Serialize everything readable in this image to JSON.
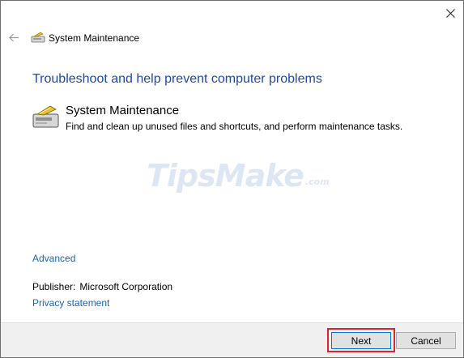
{
  "window": {
    "title": "System Maintenance",
    "close_icon": "close-icon",
    "back_icon": "back-arrow-icon"
  },
  "main": {
    "heading": "Troubleshoot and help prevent computer problems",
    "tool": {
      "icon": "system-maintenance-icon",
      "name": "System Maintenance",
      "description": "Find and clean up unused files and shortcuts, and perform maintenance tasks."
    },
    "watermark": {
      "text": "TipsMake",
      "domain": ".com"
    },
    "advanced_label": "Advanced",
    "publisher_label": "Publisher:",
    "publisher_name": "Microsoft Corporation",
    "privacy_label": "Privacy statement"
  },
  "footer": {
    "next_label": "Next",
    "cancel_label": "Cancel"
  },
  "colors": {
    "heading": "#1e4aa8",
    "link": "#1a63c3",
    "highlight": "#e0232e"
  }
}
